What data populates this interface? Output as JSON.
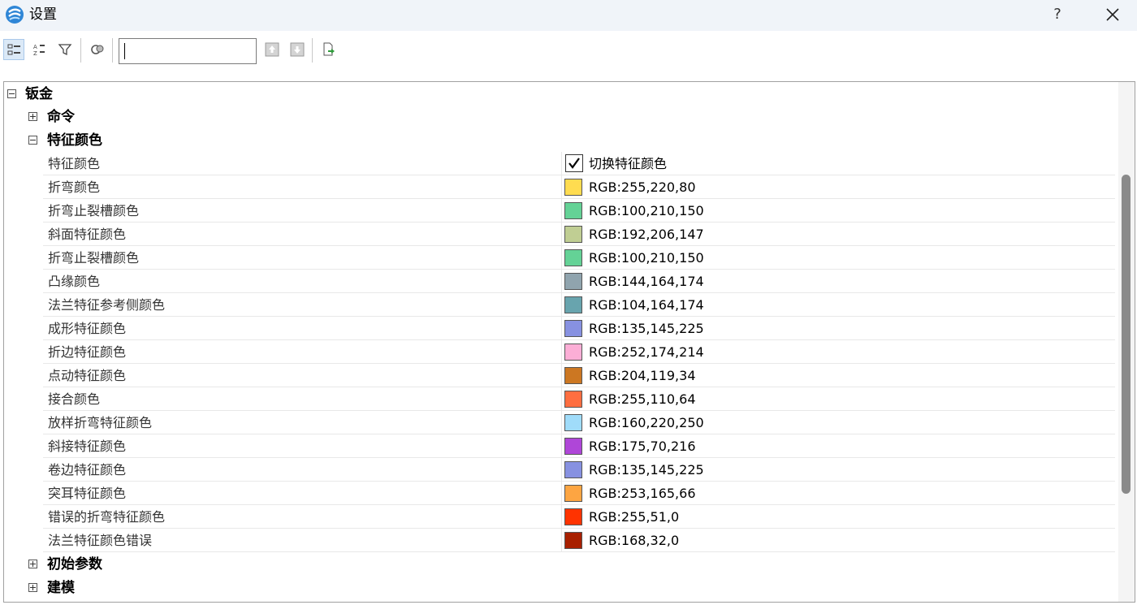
{
  "window": {
    "title": "设置",
    "help_label": "?",
    "logo_icon": "app-logo-icon",
    "close_icon": "close-icon"
  },
  "toolbar": {
    "search_value": "",
    "buttons": [
      "categorized-view-icon",
      "alphabetical-sort-icon",
      "filter-icon",
      "settings-cog-icon",
      "move-up-icon",
      "move-down-icon",
      "export-icon"
    ]
  },
  "tree": {
    "root": {
      "label": "钣金",
      "expanded": true
    },
    "groups": {
      "commands": {
        "label": "命令",
        "expanded": false
      },
      "feature_color": {
        "label": "特征颜色",
        "expanded": true
      },
      "initial_params": {
        "label": "初始参数",
        "expanded": false
      },
      "modeling": {
        "label": "建模",
        "expanded": false
      }
    },
    "feature_toggle": {
      "name": "特征颜色",
      "checked": true,
      "value": "切换特征颜色"
    },
    "properties": [
      {
        "name": "折弯颜色",
        "value": "RGB:255,220,80",
        "color": "#FFDC50"
      },
      {
        "name": "折弯止裂槽颜色",
        "value": "RGB:100,210,150",
        "color": "#64D296"
      },
      {
        "name": "斜面特征颜色",
        "value": "RGB:192,206,147",
        "color": "#C0CE93"
      },
      {
        "name": "折弯止裂槽颜色",
        "value": "RGB:100,210,150",
        "color": "#64D296"
      },
      {
        "name": "凸缘颜色",
        "value": "RGB:144,164,174",
        "color": "#90A4AE"
      },
      {
        "name": "法兰特征参考侧颜色",
        "value": "RGB:104,164,174",
        "color": "#68A4AE"
      },
      {
        "name": "成形特征颜色",
        "value": "RGB:135,145,225",
        "color": "#8791E1"
      },
      {
        "name": "折边特征颜色",
        "value": "RGB:252,174,214",
        "color": "#FCAED6"
      },
      {
        "name": "点动特征颜色",
        "value": "RGB:204,119,34",
        "color": "#CC7722"
      },
      {
        "name": "接合颜色",
        "value": "RGB:255,110,64",
        "color": "#FF6E40"
      },
      {
        "name": "放样折弯特征颜色",
        "value": "RGB:160,220,250",
        "color": "#A0DCFA"
      },
      {
        "name": "斜接特征颜色",
        "value": "RGB:175,70,216",
        "color": "#AF46D8"
      },
      {
        "name": "卷边特征颜色",
        "value": "RGB:135,145,225",
        "color": "#8791E1"
      },
      {
        "name": "突耳特征颜色",
        "value": "RGB:253,165,66",
        "color": "#FDA542"
      },
      {
        "name": "错误的折弯特征颜色",
        "value": "RGB:255,51,0",
        "color": "#FF3300"
      },
      {
        "name": "法兰特征颜色错误",
        "value": "RGB:168,32,0",
        "color": "#A82000"
      }
    ]
  }
}
